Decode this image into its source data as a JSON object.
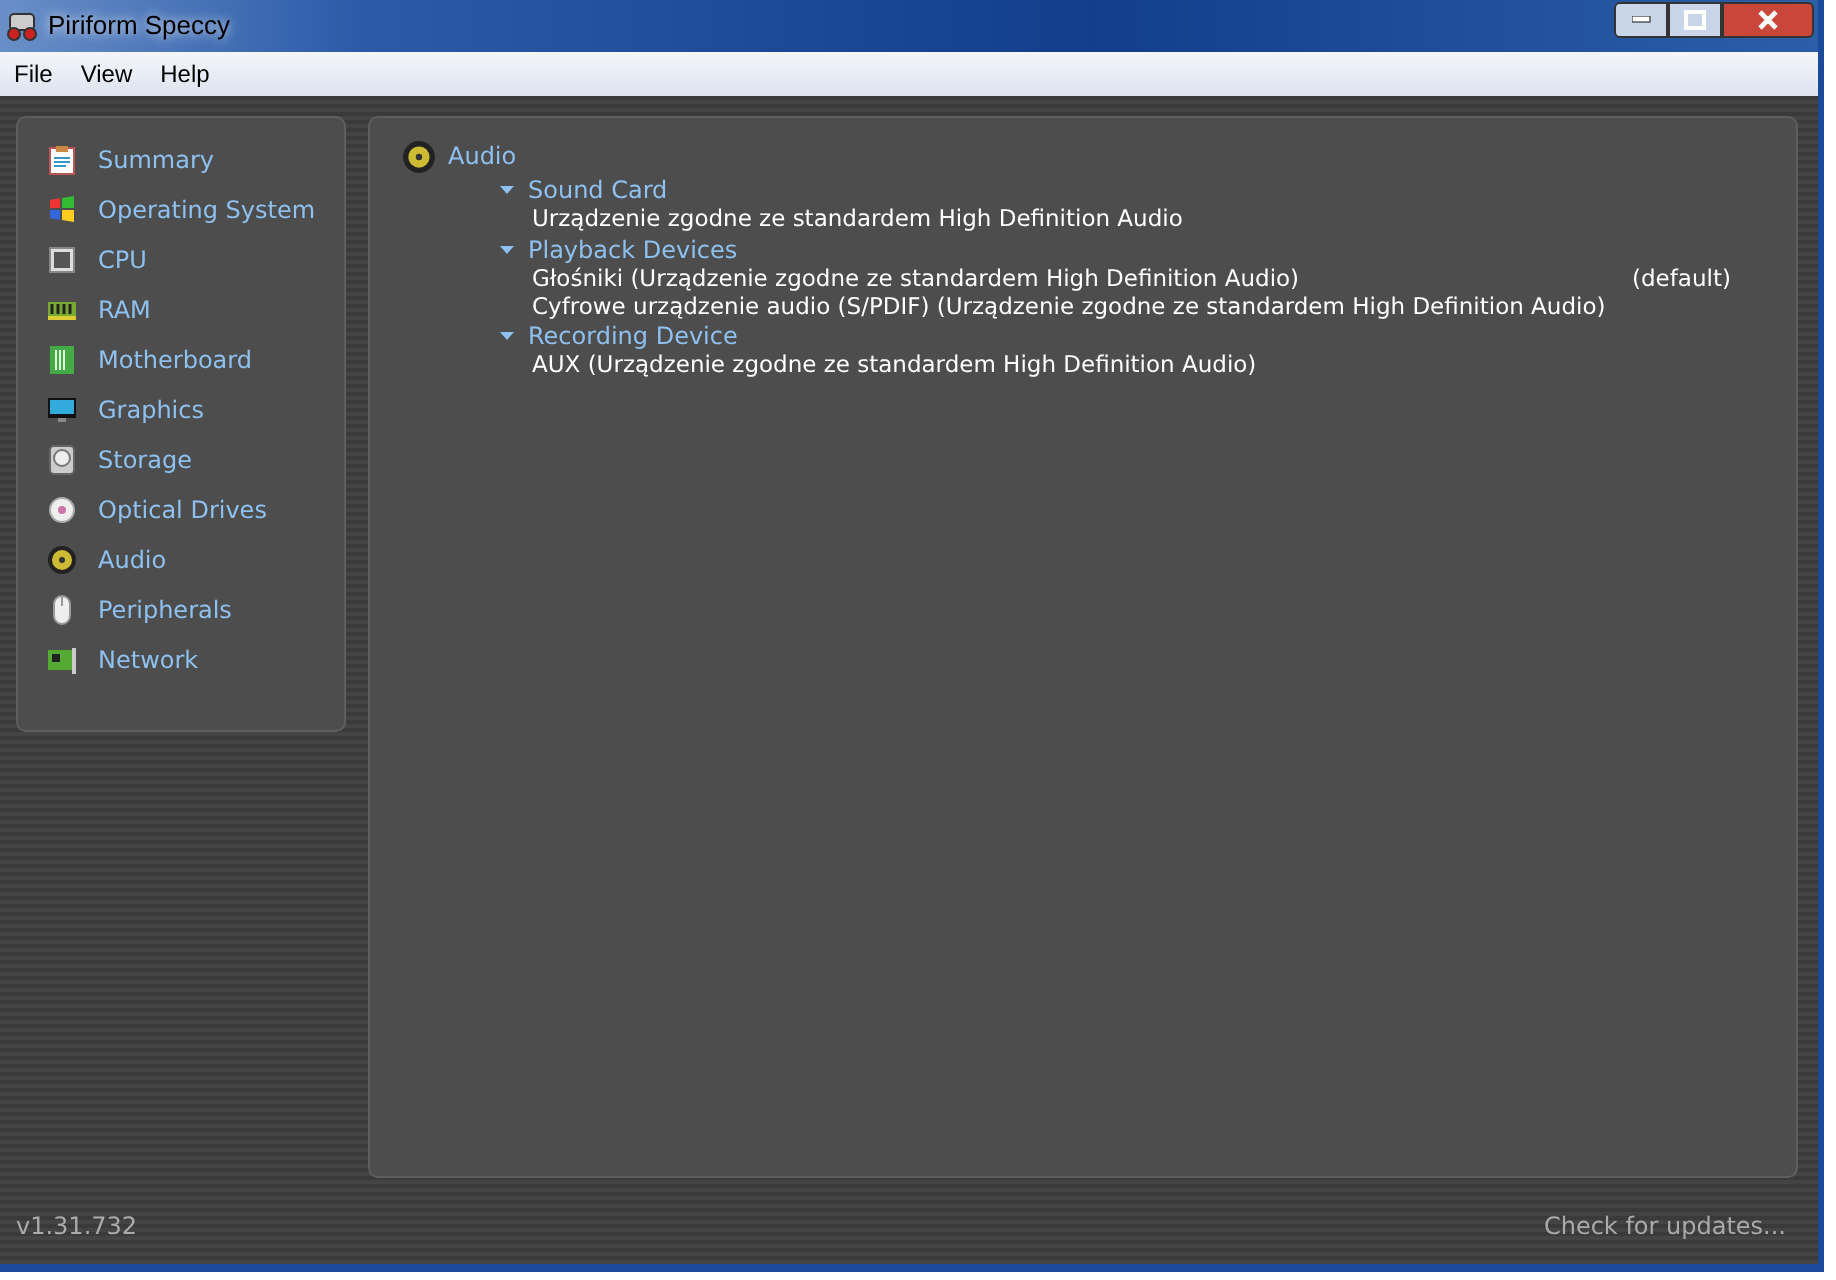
{
  "window": {
    "title": "Piriform Speccy"
  },
  "menu": [
    "File",
    "View",
    "Help"
  ],
  "sidebar": {
    "items": [
      {
        "label": "Summary"
      },
      {
        "label": "Operating System"
      },
      {
        "label": "CPU"
      },
      {
        "label": "RAM"
      },
      {
        "label": "Motherboard"
      },
      {
        "label": "Graphics"
      },
      {
        "label": "Storage"
      },
      {
        "label": "Optical Drives"
      },
      {
        "label": "Audio"
      },
      {
        "label": "Peripherals"
      },
      {
        "label": "Network"
      }
    ]
  },
  "content": {
    "heading": "Audio",
    "sections": [
      {
        "title": "Sound Card",
        "expanded": true,
        "rows": [
          {
            "text": "Urządzenie zgodne ze standardem High Definition Audio"
          }
        ]
      },
      {
        "title": "Playback Devices",
        "expanded": true,
        "rows": [
          {
            "text": "Głośniki (Urządzenie zgodne ze standardem High Definition Audio)",
            "note": "(default)"
          },
          {
            "text": "Cyfrowe urządzenie audio (S/PDIF) (Urządzenie zgodne ze standardem High Definition Audio)"
          }
        ]
      },
      {
        "title": "Recording Device",
        "expanded": true,
        "rows": [
          {
            "text": "AUX (Urządzenie zgodne ze standardem High Definition Audio)"
          }
        ]
      }
    ]
  },
  "status_bar": {
    "version": "v1.31.732",
    "link": "Check for updates..."
  }
}
